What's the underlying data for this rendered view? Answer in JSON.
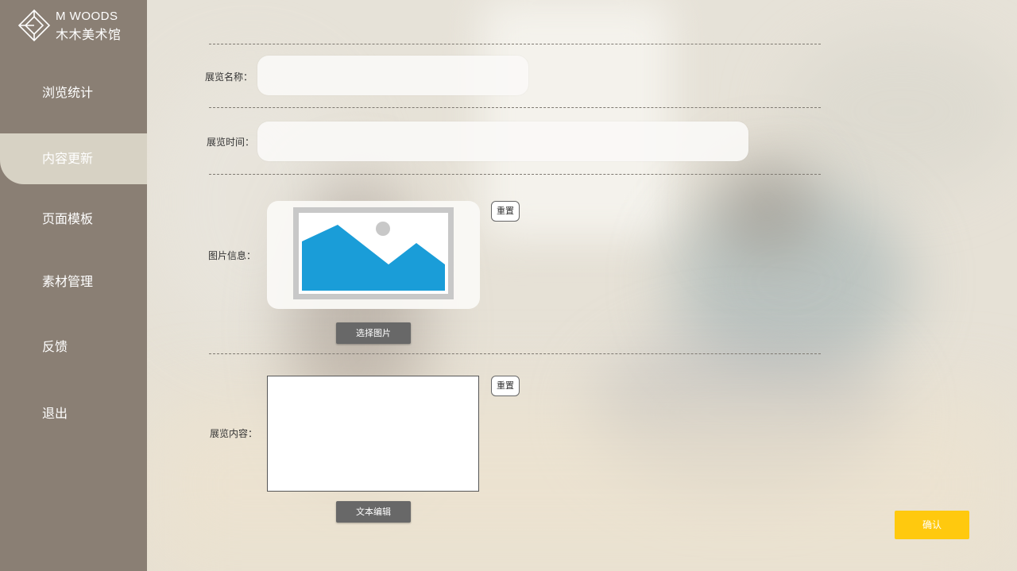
{
  "brand": {
    "name_en": "M WOODS",
    "name_cn": "木木美术馆"
  },
  "sidebar": {
    "items": [
      {
        "label": "浏览统计",
        "active": false
      },
      {
        "label": "内容更新",
        "active": true
      },
      {
        "label": "页面模板",
        "active": false
      },
      {
        "label": "素材管理",
        "active": false
      },
      {
        "label": "反馈",
        "active": false
      },
      {
        "label": "退出",
        "active": false
      }
    ]
  },
  "form": {
    "name_label": "展览名称：",
    "name_value": "",
    "time_label": "展览时间：",
    "time_value": "",
    "image_label": "图片信息：",
    "image_reset": "重置",
    "choose_image": "选择图片",
    "content_label": "展览内容：",
    "content_reset": "重置",
    "text_edit": "文本编辑",
    "content_value": "",
    "confirm": "确认"
  },
  "colors": {
    "sidebar": "#8a7f74",
    "active_item": "#d7d2c4",
    "confirm": "#ffc90e",
    "image_placeholder": "#1a9dd8"
  },
  "icons": {
    "logo": "diamond-logo-icon",
    "image_placeholder": "image-placeholder-icon"
  }
}
